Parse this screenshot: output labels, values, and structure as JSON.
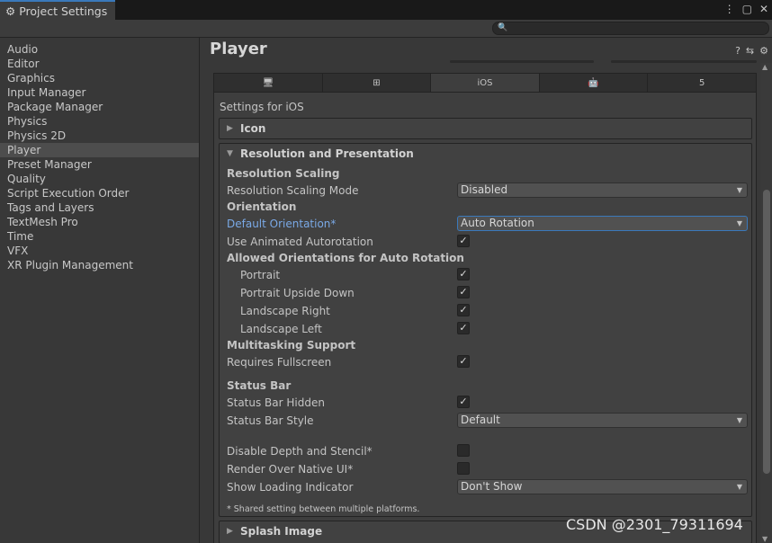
{
  "window": {
    "tab_title": "Project Settings",
    "tab_icon": "gear-icon"
  },
  "sidebar": {
    "items": [
      {
        "label": "Audio"
      },
      {
        "label": "Editor"
      },
      {
        "label": "Graphics"
      },
      {
        "label": "Input Manager"
      },
      {
        "label": "Package Manager"
      },
      {
        "label": "Physics"
      },
      {
        "label": "Physics 2D"
      },
      {
        "label": "Player",
        "selected": true
      },
      {
        "label": "Preset Manager"
      },
      {
        "label": "Quality"
      },
      {
        "label": "Script Execution Order"
      },
      {
        "label": "Tags and Layers"
      },
      {
        "label": "TextMesh Pro"
      },
      {
        "label": "Time"
      },
      {
        "label": "VFX"
      },
      {
        "label": "XR Plugin Management"
      }
    ]
  },
  "main": {
    "title": "Player",
    "platform_tabs": [
      {
        "icon": "monitor-icon",
        "label": ""
      },
      {
        "icon": "windows-icon",
        "label": ""
      },
      {
        "icon": "",
        "label": "iOS",
        "active": true
      },
      {
        "icon": "android-icon",
        "label": ""
      },
      {
        "icon": "html5-icon",
        "label": ""
      }
    ],
    "settings_for": "Settings for iOS",
    "icon_section": "Icon",
    "resolution": {
      "header": "Resolution and Presentation",
      "resolution_scaling": "Resolution Scaling",
      "resolution_scaling_mode": {
        "label": "Resolution Scaling Mode",
        "value": "Disabled"
      },
      "orientation": "Orientation",
      "default_orientation": {
        "label": "Default Orientation*",
        "value": "Auto Rotation"
      },
      "use_animated_autorotation": {
        "label": "Use Animated Autorotation",
        "checked": true
      },
      "allowed_orientations": "Allowed Orientations for Auto Rotation",
      "portrait": {
        "label": "Portrait",
        "checked": true
      },
      "portrait_upside_down": {
        "label": "Portrait Upside Down",
        "checked": true
      },
      "landscape_right": {
        "label": "Landscape Right",
        "checked": true
      },
      "landscape_left": {
        "label": "Landscape Left",
        "checked": true
      },
      "multitasking_support": "Multitasking Support",
      "requires_fullscreen": {
        "label": "Requires Fullscreen",
        "checked": true
      },
      "status_bar": "Status Bar",
      "status_bar_hidden": {
        "label": "Status Bar Hidden",
        "checked": true
      },
      "status_bar_style": {
        "label": "Status Bar Style",
        "value": "Default"
      },
      "disable_depth_stencil": {
        "label": "Disable Depth and Stencil*",
        "checked": false
      },
      "render_over_native_ui": {
        "label": "Render Over Native UI*",
        "checked": false
      },
      "show_loading_indicator": {
        "label": "Show Loading Indicator",
        "value": "Don't Show"
      },
      "footnote": "* Shared setting between multiple platforms."
    },
    "splash_section": "Splash Image"
  },
  "watermark": "CSDN @2301_79311694",
  "glyphs": {
    "check": "✓",
    "dropdown_arrow": "▼",
    "collapsed": "▶",
    "expanded": "▼",
    "menu": "⋮",
    "maximize": "▢",
    "close": "✕",
    "help": "?",
    "presets": "⇆",
    "gear": "⚙",
    "search": "🔍",
    "monitor": "🖥",
    "windows": "⊞",
    "android": "🤖",
    "html5": "5",
    "scroll_up": "▲",
    "scroll_down": "▼"
  },
  "colors": {
    "accent": "#3a79bb",
    "link_blue": "#7aa9e6",
    "background": "#383838",
    "selection": "#4d4d4d"
  }
}
